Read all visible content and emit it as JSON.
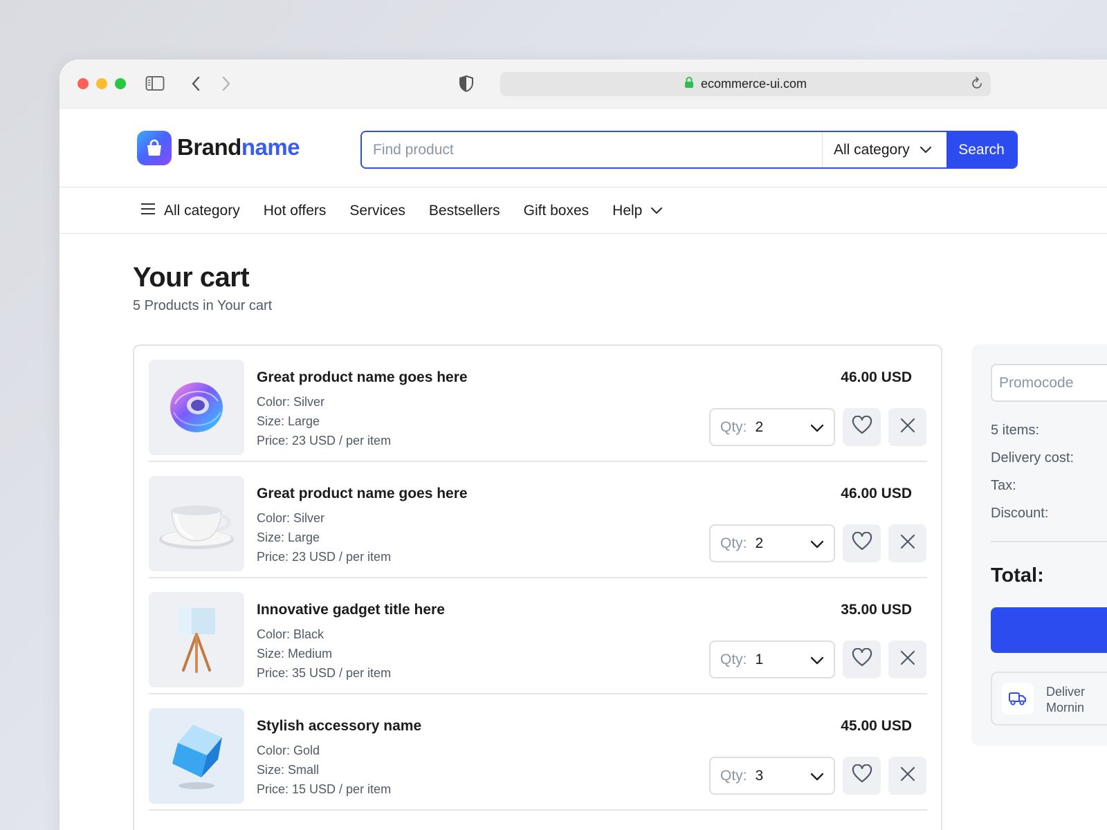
{
  "browser": {
    "url": "ecommerce-ui.com"
  },
  "header": {
    "logo_brand": "Brand",
    "logo_name": "name",
    "search_placeholder": "Find product",
    "search_category": "All category",
    "search_button": "Search"
  },
  "nav": {
    "items": [
      {
        "label": "All category"
      },
      {
        "label": "Hot offers"
      },
      {
        "label": "Services"
      },
      {
        "label": "Bestsellers"
      },
      {
        "label": "Gift boxes"
      },
      {
        "label": "Help"
      }
    ]
  },
  "cart": {
    "title": "Your cart",
    "subtitle": "5 Products in Your cart",
    "qty_label": "Qty:",
    "items": [
      {
        "name": "Great product name goes here",
        "color": "Color: Silver",
        "size": "Size: Large",
        "price": "Price: 23 USD / per item",
        "total": "46.00 USD",
        "qty": "2",
        "image": "torus-ring"
      },
      {
        "name": "Great product name goes here",
        "color": "Color: Silver",
        "size": "Size: Large",
        "price": "Price: 23 USD / per item",
        "total": "46.00 USD",
        "qty": "2",
        "image": "cup-saucer"
      },
      {
        "name": "Innovative gadget title here",
        "color": "Color: Black",
        "size": "Size: Medium",
        "price": "Price: 35 USD / per item",
        "total": "35.00 USD",
        "qty": "1",
        "image": "lamp"
      },
      {
        "name": "Stylish accessory name",
        "color": "Color: Gold",
        "size": "Size: Small",
        "price": "Price: 15 USD / per item",
        "total": "45.00 USD",
        "qty": "3",
        "image": "cube"
      }
    ]
  },
  "summary": {
    "promo_placeholder": "Promocode",
    "items_label": "5 items:",
    "delivery_label": "Delivery cost:",
    "tax_label": "Tax:",
    "discount_label": "Discount:",
    "total_label": "Total:",
    "delivery_line1": "Deliver",
    "delivery_line2": "Mornin"
  },
  "colors": {
    "accent": "#2d4cf0",
    "text": "#1c1c1c",
    "muted": "#505967",
    "surface": "#eef0f3"
  }
}
